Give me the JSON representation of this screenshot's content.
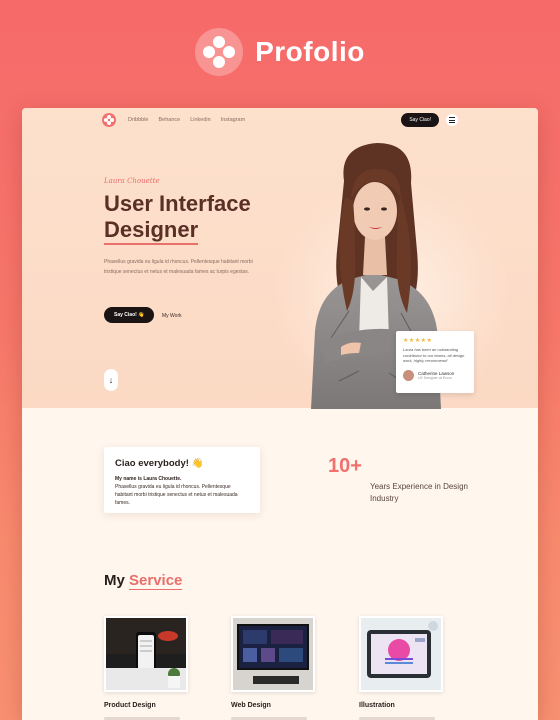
{
  "brand": {
    "name": "Profolio",
    "logo_icon": "dots-flower-icon"
  },
  "nav": {
    "links": [
      "Dribbble",
      "Behance",
      "Linkedin",
      "Instagram"
    ],
    "cta": "Say Ciao!"
  },
  "hero": {
    "kicker": "Laura Chouette",
    "title_line1": "User Interface",
    "title_line2": "Designer",
    "description": "Phasellus gravida eu ligula id rhoncus. Pellentesque habitant morbi tristique senectus et netus et malesuada fames ac turpis egestas.",
    "cta": "Say Ciao! 👋",
    "secondary": "My Work"
  },
  "review": {
    "stars": "★★★★★",
    "quote": "Laura has been an outstanding contributor to our teams; all design work, highly recommend!",
    "name": "Catherine Lawson",
    "role": "UX Designer at Ecom"
  },
  "about": {
    "title": "Ciao everybody! 👋",
    "name_line": "My name is Laura Chouette.",
    "text": "Phasellus gravida eu ligula id rhoncus. Pellentesque habitant morbi tristique senectus et netus et malesuada fames."
  },
  "stats": {
    "number": "10+",
    "label": "Years Experience in Design Industry"
  },
  "services": {
    "title_prefix": "My ",
    "title_accent": "Service",
    "items": [
      {
        "label": "Product Design"
      },
      {
        "label": "Web Design"
      },
      {
        "label": "Illustration"
      }
    ]
  },
  "colors": {
    "accent": "#f2706d",
    "dark": "#1b1414",
    "hero_bg": "#fde1cd",
    "page_bg": "#fff6ee"
  }
}
